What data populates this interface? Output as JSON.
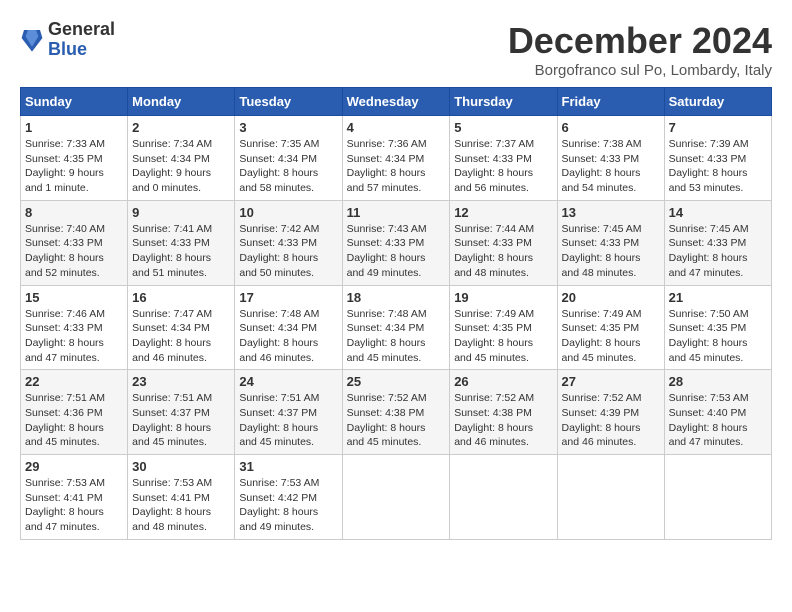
{
  "header": {
    "logo_general": "General",
    "logo_blue": "Blue",
    "month": "December 2024",
    "location": "Borgofranco sul Po, Lombardy, Italy"
  },
  "days_of_week": [
    "Sunday",
    "Monday",
    "Tuesday",
    "Wednesday",
    "Thursday",
    "Friday",
    "Saturday"
  ],
  "weeks": [
    [
      {
        "day": "1",
        "sunrise": "7:33 AM",
        "sunset": "4:35 PM",
        "daylight": "9 hours and 1 minute."
      },
      {
        "day": "2",
        "sunrise": "7:34 AM",
        "sunset": "4:34 PM",
        "daylight": "9 hours and 0 minutes."
      },
      {
        "day": "3",
        "sunrise": "7:35 AM",
        "sunset": "4:34 PM",
        "daylight": "8 hours and 58 minutes."
      },
      {
        "day": "4",
        "sunrise": "7:36 AM",
        "sunset": "4:34 PM",
        "daylight": "8 hours and 57 minutes."
      },
      {
        "day": "5",
        "sunrise": "7:37 AM",
        "sunset": "4:33 PM",
        "daylight": "8 hours and 56 minutes."
      },
      {
        "day": "6",
        "sunrise": "7:38 AM",
        "sunset": "4:33 PM",
        "daylight": "8 hours and 54 minutes."
      },
      {
        "day": "7",
        "sunrise": "7:39 AM",
        "sunset": "4:33 PM",
        "daylight": "8 hours and 53 minutes."
      }
    ],
    [
      {
        "day": "8",
        "sunrise": "7:40 AM",
        "sunset": "4:33 PM",
        "daylight": "8 hours and 52 minutes."
      },
      {
        "day": "9",
        "sunrise": "7:41 AM",
        "sunset": "4:33 PM",
        "daylight": "8 hours and 51 minutes."
      },
      {
        "day": "10",
        "sunrise": "7:42 AM",
        "sunset": "4:33 PM",
        "daylight": "8 hours and 50 minutes."
      },
      {
        "day": "11",
        "sunrise": "7:43 AM",
        "sunset": "4:33 PM",
        "daylight": "8 hours and 49 minutes."
      },
      {
        "day": "12",
        "sunrise": "7:44 AM",
        "sunset": "4:33 PM",
        "daylight": "8 hours and 48 minutes."
      },
      {
        "day": "13",
        "sunrise": "7:45 AM",
        "sunset": "4:33 PM",
        "daylight": "8 hours and 48 minutes."
      },
      {
        "day": "14",
        "sunrise": "7:45 AM",
        "sunset": "4:33 PM",
        "daylight": "8 hours and 47 minutes."
      }
    ],
    [
      {
        "day": "15",
        "sunrise": "7:46 AM",
        "sunset": "4:33 PM",
        "daylight": "8 hours and 47 minutes."
      },
      {
        "day": "16",
        "sunrise": "7:47 AM",
        "sunset": "4:34 PM",
        "daylight": "8 hours and 46 minutes."
      },
      {
        "day": "17",
        "sunrise": "7:48 AM",
        "sunset": "4:34 PM",
        "daylight": "8 hours and 46 minutes."
      },
      {
        "day": "18",
        "sunrise": "7:48 AM",
        "sunset": "4:34 PM",
        "daylight": "8 hours and 45 minutes."
      },
      {
        "day": "19",
        "sunrise": "7:49 AM",
        "sunset": "4:35 PM",
        "daylight": "8 hours and 45 minutes."
      },
      {
        "day": "20",
        "sunrise": "7:49 AM",
        "sunset": "4:35 PM",
        "daylight": "8 hours and 45 minutes."
      },
      {
        "day": "21",
        "sunrise": "7:50 AM",
        "sunset": "4:35 PM",
        "daylight": "8 hours and 45 minutes."
      }
    ],
    [
      {
        "day": "22",
        "sunrise": "7:51 AM",
        "sunset": "4:36 PM",
        "daylight": "8 hours and 45 minutes."
      },
      {
        "day": "23",
        "sunrise": "7:51 AM",
        "sunset": "4:37 PM",
        "daylight": "8 hours and 45 minutes."
      },
      {
        "day": "24",
        "sunrise": "7:51 AM",
        "sunset": "4:37 PM",
        "daylight": "8 hours and 45 minutes."
      },
      {
        "day": "25",
        "sunrise": "7:52 AM",
        "sunset": "4:38 PM",
        "daylight": "8 hours and 45 minutes."
      },
      {
        "day": "26",
        "sunrise": "7:52 AM",
        "sunset": "4:38 PM",
        "daylight": "8 hours and 46 minutes."
      },
      {
        "day": "27",
        "sunrise": "7:52 AM",
        "sunset": "4:39 PM",
        "daylight": "8 hours and 46 minutes."
      },
      {
        "day": "28",
        "sunrise": "7:53 AM",
        "sunset": "4:40 PM",
        "daylight": "8 hours and 47 minutes."
      }
    ],
    [
      {
        "day": "29",
        "sunrise": "7:53 AM",
        "sunset": "4:41 PM",
        "daylight": "8 hours and 47 minutes."
      },
      {
        "day": "30",
        "sunrise": "7:53 AM",
        "sunset": "4:41 PM",
        "daylight": "8 hours and 48 minutes."
      },
      {
        "day": "31",
        "sunrise": "7:53 AM",
        "sunset": "4:42 PM",
        "daylight": "8 hours and 49 minutes."
      },
      null,
      null,
      null,
      null
    ]
  ]
}
